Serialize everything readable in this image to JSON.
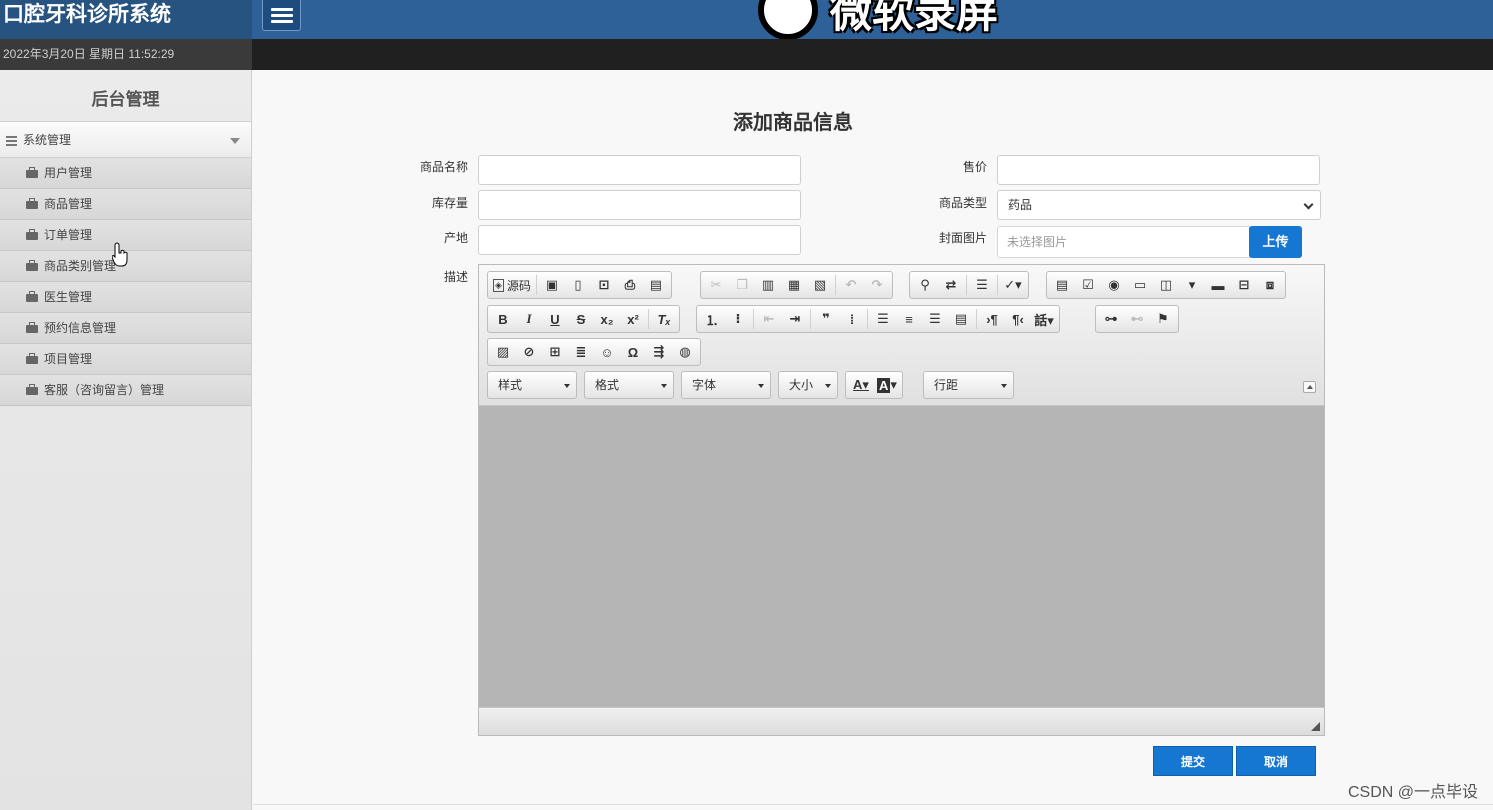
{
  "header": {
    "app_title": "口腔牙科诊所系统",
    "watermark": "微软录屏"
  },
  "datebar": {
    "datetime": "2022年3月20日 星期日 11:52:29"
  },
  "sidebar": {
    "heading": "后台管理",
    "group": "系统管理",
    "items": [
      {
        "label": "用户管理"
      },
      {
        "label": "商品管理"
      },
      {
        "label": "订单管理"
      },
      {
        "label": "商品类别管理"
      },
      {
        "label": "医生管理"
      },
      {
        "label": "预约信息管理"
      },
      {
        "label": "项目管理"
      },
      {
        "label": "客服（咨询留言）管理"
      }
    ]
  },
  "form": {
    "title": "添加商品信息",
    "labels": {
      "name": "商品名称",
      "price": "售价",
      "stock": "库存量",
      "category": "商品类型",
      "origin": "产地",
      "cover": "封面图片",
      "description": "描述"
    },
    "values": {
      "name": "",
      "price": "",
      "stock": "",
      "origin": ""
    },
    "category_selected": "药品",
    "cover_placeholder": "未选择图片",
    "upload_label": "上传",
    "submit_label": "提交",
    "cancel_label": "取消"
  },
  "editor": {
    "source_label": "源码",
    "combos": {
      "styles": "样式",
      "format": "格式",
      "font": "字体",
      "size": "大小",
      "line_height": "行距"
    }
  },
  "footer": {
    "watermark": "CSDN @一点毕设"
  }
}
